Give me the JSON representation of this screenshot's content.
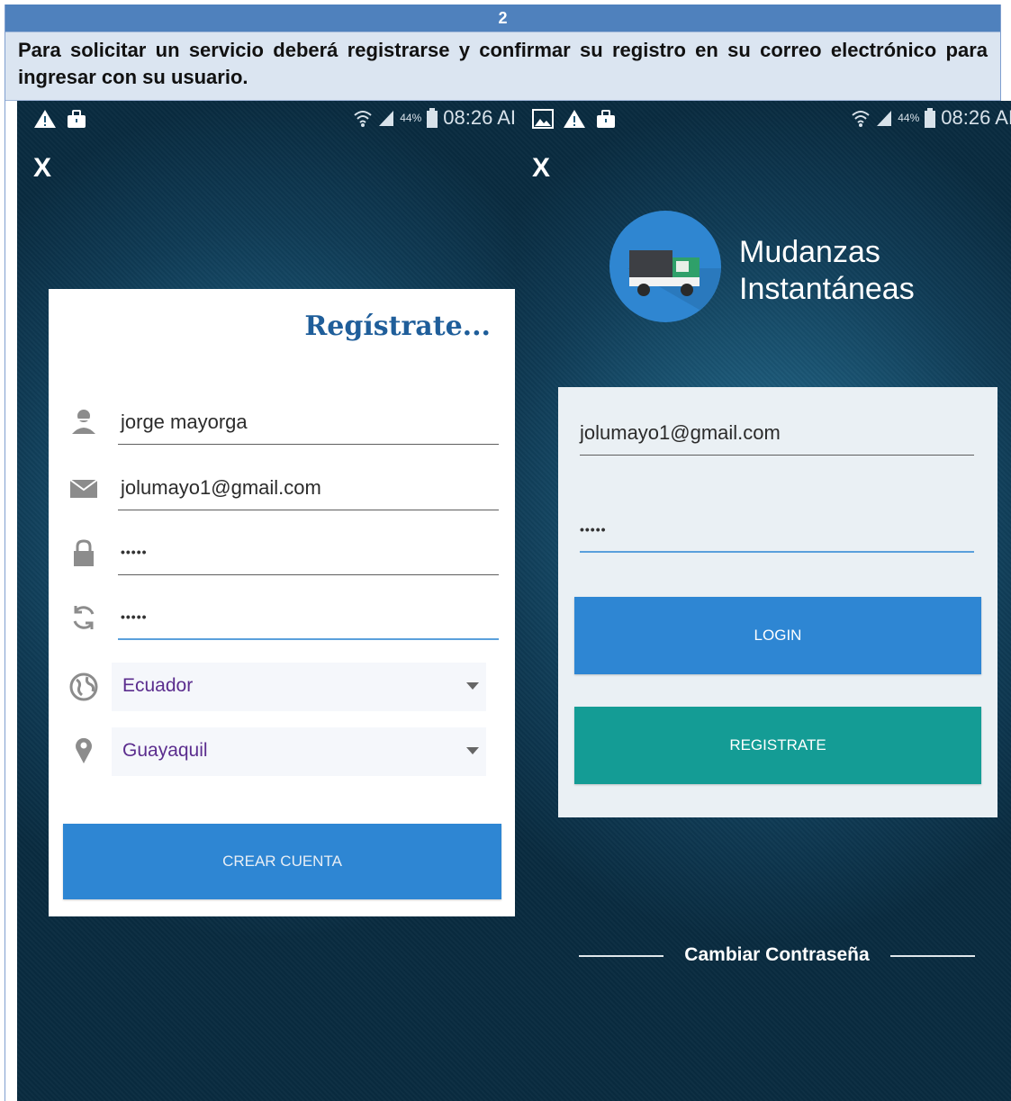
{
  "document": {
    "step_number": "2",
    "instruction": "Para solicitar un servicio deberá registrarse y confirmar su registro en su correo electrónico para ingresar con su usuario."
  },
  "status_bar": {
    "battery_percent": "44%",
    "time": "08:26 AI",
    "icons": [
      "warning-icon",
      "briefcase-icon",
      "wifi-icon",
      "signal-icon",
      "battery-icon",
      "image-icon"
    ]
  },
  "register_screen": {
    "close_label": "X",
    "title": "Regístrate...",
    "name_value": "jorge mayorga",
    "email_value": "jolumayo1@gmail.com",
    "password_value": "•••••",
    "confirm_password_value": "•••••",
    "country_value": "Ecuador",
    "city_value": "Guayaquil",
    "create_button": "CREAR CUENTA"
  },
  "login_screen": {
    "close_label": "X",
    "app_name_line1": "Mudanzas",
    "app_name_line2": "Instantáneas",
    "email_value": "jolumayo1@gmail.com",
    "password_value": "•••••",
    "login_button": "LOGIN",
    "register_button": "REGISTRATE",
    "change_password_link": "Cambiar Contraseña"
  },
  "colors": {
    "header_blue": "#4f81bd",
    "instruction_bg": "#dbe5f1",
    "primary_button": "#2e86d3",
    "teal_button": "#149c95",
    "title_blue": "#1f5e9a",
    "select_text": "#5b2d8e"
  }
}
